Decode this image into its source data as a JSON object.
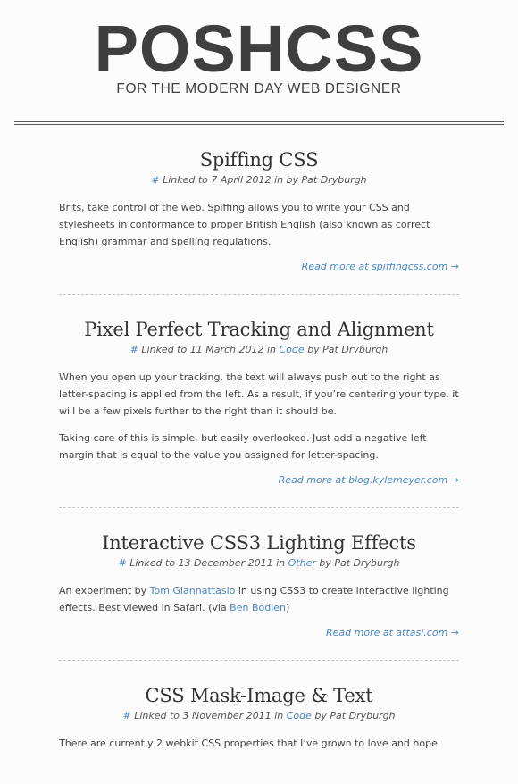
{
  "site": {
    "logo": "POSHCSS",
    "tagline": "FOR THE MODERN DAY WEB DESIGNER"
  },
  "colors": {
    "link": "#4a86c5",
    "text": "#444444",
    "logo": "#3f3f3f"
  },
  "posts": [
    {
      "title": "Spiffing CSS",
      "meta": {
        "hash": "#",
        "linked": "Linked to 7 April 2012",
        "in": "",
        "category": "",
        "by": "in by Pat Dryburgh"
      },
      "paragraphs": [
        {
          "parts": [
            {
              "text": "Brits, take control of the web. Spiffing allows you to write your CSS and stylesheets in conformance to proper British English (also known as correct English) grammar and spelling regulations."
            }
          ]
        }
      ],
      "read_more": "Read more at spiffingcss.com →"
    },
    {
      "title": "Pixel Perfect Tracking and Alignment",
      "meta": {
        "hash": "#",
        "linked": "Linked to 11 March 2012",
        "in": "in",
        "category": "Code",
        "by": "by Pat Dryburgh"
      },
      "paragraphs": [
        {
          "parts": [
            {
              "text": "When you open up your tracking, the text will always push out to the right as letter-spacing is applied from the left. As a result, if you’re centering your type, it will be a few pixels further to the right than it should be."
            }
          ]
        },
        {
          "parts": [
            {
              "text": "Taking care of this is simple, but easily overlooked. Just add a negative left margin that is equal to the value you assigned for letter-spacing."
            }
          ]
        }
      ],
      "read_more": "Read more at blog.kylemeyer.com →"
    },
    {
      "title": "Interactive CSS3 Lighting Effects",
      "meta": {
        "hash": "#",
        "linked": "Linked to 13 December 2011",
        "in": "in",
        "category": "Other",
        "by": "by Pat Dryburgh"
      },
      "paragraphs": [
        {
          "parts": [
            {
              "text": "An experiment by "
            },
            {
              "text": "Tom Giannattasio",
              "link": true
            },
            {
              "text": " in using CSS3 to create interactive lighting effects. Best viewed in Safari. (via "
            },
            {
              "text": "Ben Bodien",
              "link": true
            },
            {
              "text": ")"
            }
          ]
        }
      ],
      "read_more": "Read more at attasi.com →"
    },
    {
      "title": "CSS Mask-Image & Text",
      "meta": {
        "hash": "#",
        "linked": "Linked to 3 November 2011",
        "in": "in",
        "category": "Code",
        "by": "by Pat Dryburgh"
      },
      "paragraphs": [
        {
          "parts": [
            {
              "text": "There are currently 2 webkit CSS properties that I’ve grown to love and hope"
            }
          ]
        }
      ],
      "read_more": ""
    }
  ]
}
